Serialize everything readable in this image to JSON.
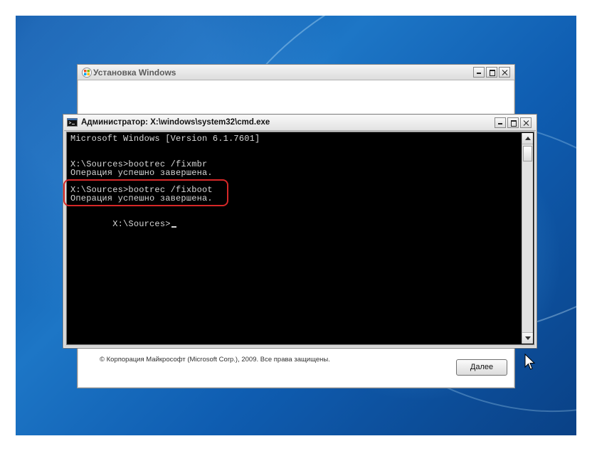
{
  "setup_window": {
    "title": "Установка Windows",
    "footer_text": "© Корпорация Майкрософт (Microsoft Corp.), 2009. Все права защищены.",
    "next_button_label": "Далее"
  },
  "cmd_window": {
    "title": "Администратор: X:\\windows\\system32\\cmd.exe",
    "lines": [
      "Microsoft Windows [Version 6.1.7601]",
      "X:\\Sources>bootrec /fixmbr",
      "Операция успешно завершена.",
      "X:\\Sources>bootrec /fixboot",
      "Операция успешно завершена.",
      "X:\\Sources>"
    ]
  },
  "icons": {
    "setup_window": "windows-setup-icon",
    "cmd_window": "command-prompt-icon",
    "minimize": "minimize-icon",
    "maximize": "maximize-icon",
    "close": "close-icon",
    "scroll_up": "scroll-up-icon",
    "scroll_down": "scroll-down-icon",
    "mouse": "mouse-pointer-icon"
  },
  "colors": {
    "console_background": "#000000",
    "console_text": "#d7d7d7",
    "highlight": "#d62828"
  }
}
